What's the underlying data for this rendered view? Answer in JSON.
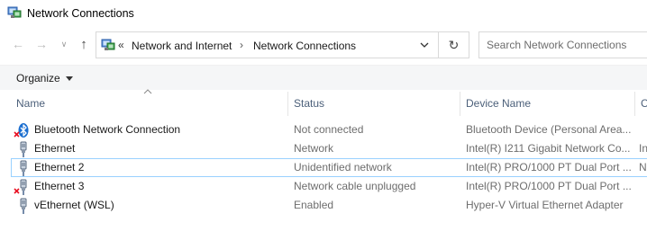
{
  "window": {
    "title": "Network Connections",
    "app_icon": "network-connections-icon"
  },
  "nav": {
    "back_icon": "back-arrow-icon",
    "forward_icon": "forward-arrow-icon",
    "recent_icon": "chevron-down-icon",
    "up_icon": "up-arrow-icon",
    "breadcrumb_overflow": "«",
    "breadcrumbs": [
      "Network and Internet",
      "Network Connections"
    ],
    "refresh_icon": "refresh-icon",
    "search_placeholder": "Search Network Connections"
  },
  "toolbar": {
    "organize_label": "Organize"
  },
  "columns": {
    "name": "Name",
    "status": "Status",
    "device": "Device Name",
    "extra": "C"
  },
  "rows": [
    {
      "name": "Bluetooth Network Connection",
      "status": "Not connected",
      "device": "Bluetooth Device (Personal Area...",
      "extra": "",
      "icon": "bluetooth-icon",
      "disconnected": true
    },
    {
      "name": "Ethernet",
      "status": "Network",
      "device": "Intel(R) I211 Gigabit Network Co...",
      "extra": "In",
      "icon": "ethernet-icon",
      "disconnected": false
    },
    {
      "name": "Ethernet 2",
      "status": "Unidentified network",
      "device": "Intel(R) PRO/1000 PT Dual Port ...",
      "extra": "N",
      "icon": "ethernet-icon",
      "disconnected": false
    },
    {
      "name": "Ethernet 3",
      "status": "Network cable unplugged",
      "device": "Intel(R) PRO/1000 PT Dual Port ...",
      "extra": "",
      "icon": "ethernet-icon",
      "disconnected": true
    },
    {
      "name": "vEthernet (WSL)",
      "status": "Enabled",
      "device": "Hyper-V Virtual Ethernet Adapter",
      "extra": "",
      "icon": "ethernet-icon",
      "disconnected": false
    }
  ],
  "selected_row": "Ethernet 2",
  "colors": {
    "header_text": "#4c607a",
    "selection_border": "#99d1ff",
    "disconnected_mark": "#e81123",
    "bluetooth_blue": "#1c6fd0"
  }
}
